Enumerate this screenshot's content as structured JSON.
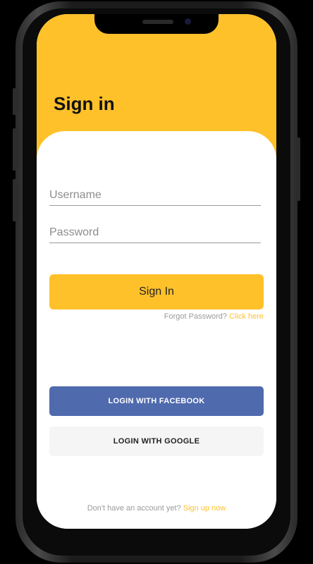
{
  "screen": {
    "title": "Sign in"
  },
  "form": {
    "username_placeholder": "Username",
    "username_value": "",
    "password_placeholder": "Password",
    "password_value": "",
    "signin_label": "Sign In",
    "forgot_text": "Forgot Password?",
    "forgot_link": "Click here"
  },
  "social": {
    "facebook_label": "LOGIN WITH FACEBOOK",
    "google_label": "LOGIN WITH GOOGLE"
  },
  "footer": {
    "signup_text": "Don't have an account yet?",
    "signup_link": "Sign up now"
  },
  "colors": {
    "accent": "#ffc12a",
    "facebook": "#4f6aad",
    "google_bg": "#f5f5f5"
  }
}
